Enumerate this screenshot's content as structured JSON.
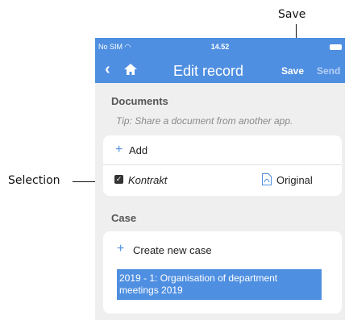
{
  "callouts": {
    "save": "Save",
    "selection": "Selection"
  },
  "status_bar": {
    "carrier": "No SIM",
    "time": "14.52"
  },
  "navbar": {
    "title": "Edit record",
    "save_label": "Save",
    "send_label": "Send"
  },
  "documents": {
    "heading": "Documents",
    "tip": "Tip: Share a document from another app.",
    "add_label": "Add",
    "items": [
      {
        "name": "Kontrakt",
        "checked": true,
        "action_label": "Original"
      }
    ]
  },
  "case": {
    "heading": "Case",
    "create_label": "Create new case",
    "selected": "2019 - 1: Organisation of department meetings 2019"
  },
  "colors": {
    "accent": "#4f8fe1",
    "background": "#efeff0"
  }
}
